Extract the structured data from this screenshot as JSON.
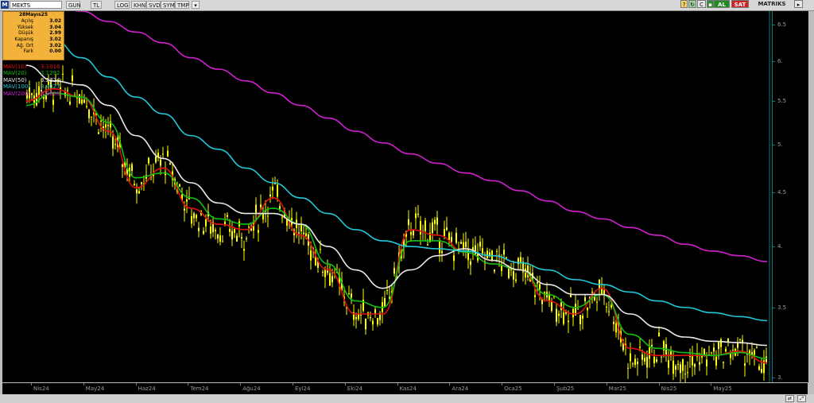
{
  "toolbar": {
    "symbol": "MEKTS",
    "buttons": [
      "GUN",
      "TL",
      "LOG",
      "KHN",
      "SVD",
      "SYM",
      "TMP"
    ],
    "right_buttons": {
      "c": "C",
      "buy": "AL",
      "sell": "SAT",
      "matrix": "MATRIKS"
    }
  },
  "colors": {
    "background": "#000000",
    "candle": "#ffff00",
    "mav10": "#e01010",
    "mav20": "#10c010",
    "mav50": "#e8e8e8",
    "mav100": "#20c8d8",
    "mav200": "#d020d0",
    "info_bg": "#f3b23a"
  },
  "info": {
    "date": "28Mayıs25",
    "rows": [
      {
        "label": "Açılış",
        "value": "3.02"
      },
      {
        "label": "Yüksek",
        "value": "3.04"
      },
      {
        "label": "Düşük",
        "value": "2.99"
      },
      {
        "label": "Kapanış",
        "value": "3.02"
      },
      {
        "label": "Ağ. Ort",
        "value": "3.02"
      },
      {
        "label": "Fark",
        "value": "0.00"
      }
    ]
  },
  "legend": [
    {
      "name": "MAV(10)",
      "value": "3.1016"
    },
    {
      "name": "MAV(20)",
      "value": "3.1292"
    },
    {
      "name": "MAV(50)",
      "value": "3.2224"
    },
    {
      "name": "MAV(100)",
      "value": "3.4027"
    },
    {
      "name": "MAV(200)",
      "value": "3.8698"
    }
  ],
  "chart_data": {
    "type": "line",
    "chart_style": "candlestick with moving averages",
    "scale": "log",
    "ylim": [
      2.97,
      6.7
    ],
    "y_ticks": [
      "6.5",
      "6.",
      "5.5",
      "5.",
      "4.5",
      "4.",
      "3.5",
      "3."
    ],
    "y_tick_values": [
      6.5,
      6.0,
      5.5,
      5.0,
      4.5,
      4.0,
      3.5,
      3.0
    ],
    "x_ticks": [
      "Nis24",
      "May24",
      "Haz24",
      "Tem24",
      "Ağu24",
      "Eyl24",
      "Eki24",
      "Kas24",
      "Ara24",
      "Oca25",
      "Şub25",
      "Mar25",
      "Nis25",
      "May25"
    ],
    "months": [
      "2024-03",
      "2024-04",
      "2024-05",
      "2024-06",
      "2024-07",
      "2024-08",
      "2024-09",
      "2024-10",
      "2024-11",
      "2024-12",
      "2025-01",
      "2025-02",
      "2025-03",
      "2025-04",
      "2025-05"
    ],
    "price": [
      5.6,
      5.65,
      5.6,
      5.1,
      4.6,
      4.85,
      4.3,
      4.15,
      4.1,
      4.5,
      4.1,
      3.8,
      3.45,
      3.45,
      4.2,
      4.1,
      3.95,
      3.9,
      3.8,
      3.55,
      3.45,
      3.65,
      3.1,
      3.2,
      3.1,
      3.15,
      3.2,
      3.05
    ],
    "series": [
      {
        "name": "MAV(10)",
        "values": [
          5.5,
          5.65,
          5.55,
          5.15,
          4.55,
          4.75,
          4.35,
          4.2,
          4.15,
          4.45,
          4.1,
          3.8,
          3.45,
          3.45,
          4.15,
          4.1,
          3.95,
          3.85,
          3.8,
          3.55,
          3.45,
          3.65,
          3.2,
          3.15,
          3.15,
          3.15,
          3.18,
          3.1
        ]
      },
      {
        "name": "MAV(20)",
        "values": [
          5.45,
          5.6,
          5.55,
          5.25,
          4.65,
          4.7,
          4.45,
          4.25,
          4.2,
          4.35,
          4.2,
          3.85,
          3.55,
          3.5,
          4.05,
          4.05,
          3.95,
          3.85,
          3.8,
          3.6,
          3.5,
          3.6,
          3.3,
          3.2,
          3.17,
          3.15,
          3.17,
          3.13
        ]
      },
      {
        "name": "MAV(50)",
        "values": [
          5.95,
          5.75,
          5.7,
          5.45,
          5.1,
          4.85,
          4.6,
          4.4,
          4.3,
          4.3,
          4.2,
          4.0,
          3.8,
          3.65,
          3.8,
          3.92,
          3.98,
          3.88,
          3.8,
          3.68,
          3.6,
          3.6,
          3.45,
          3.35,
          3.28,
          3.25,
          3.24,
          3.22
        ]
      },
      {
        "name": "MAV(100)",
        "values": [
          6.5,
          6.3,
          6.05,
          5.8,
          5.55,
          5.35,
          5.1,
          4.95,
          4.75,
          4.6,
          4.45,
          4.3,
          4.15,
          4.05,
          4.0,
          3.98,
          3.96,
          3.92,
          3.86,
          3.8,
          3.72,
          3.68,
          3.62,
          3.55,
          3.5,
          3.46,
          3.43,
          3.4
        ]
      },
      {
        "name": "MAV(200)",
        "values": [
          6.9,
          6.8,
          6.7,
          6.55,
          6.4,
          6.25,
          6.05,
          5.9,
          5.75,
          5.6,
          5.45,
          5.3,
          5.15,
          5.02,
          4.9,
          4.8,
          4.7,
          4.62,
          4.52,
          4.42,
          4.32,
          4.25,
          4.17,
          4.1,
          4.02,
          3.96,
          3.92,
          3.87
        ]
      }
    ]
  }
}
